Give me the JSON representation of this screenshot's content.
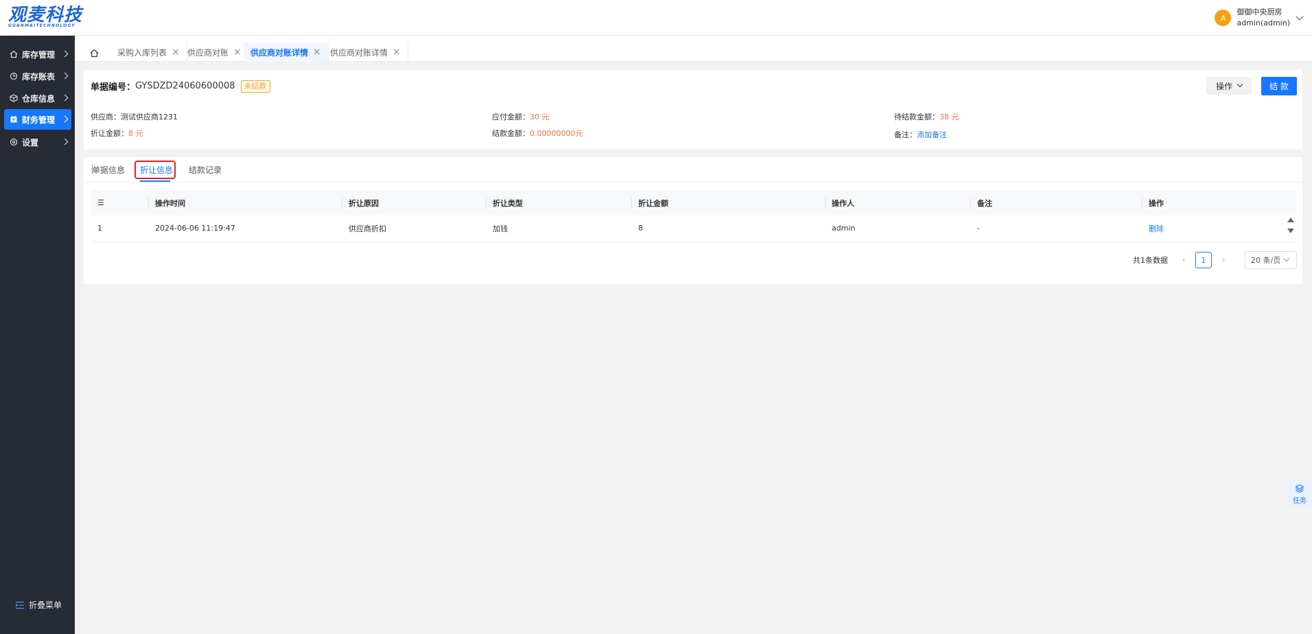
{
  "brand": {
    "name": "观麦科技",
    "subtitle": "GUANMAITECHNOLOGY"
  },
  "user": {
    "avatar_letter": "A",
    "shop": "御御中央厨房",
    "account": "admin(admin)"
  },
  "sidebar": {
    "items": [
      {
        "label": "库存管理",
        "icon": "home-icon"
      },
      {
        "label": "库存账表",
        "icon": "ledger-icon"
      },
      {
        "label": "仓库信息",
        "icon": "box-icon"
      },
      {
        "label": "财务管理",
        "icon": "finance-icon",
        "active": true
      },
      {
        "label": "设置",
        "icon": "gear-icon"
      }
    ],
    "collapse_label": "折叠菜单"
  },
  "tabs": [
    {
      "label": "采购入库列表"
    },
    {
      "label": "供应商对账"
    },
    {
      "label": "供应商对账详情",
      "active": true
    },
    {
      "label": "供应商对账详情"
    }
  ],
  "doc": {
    "number_label": "单据编号：",
    "number": "GYSDZD24060600008",
    "status": "未结款",
    "op_button": "操作",
    "settle_button": "结 款",
    "fields": {
      "supplier_label": "供应商：",
      "supplier": "测试供应商1231",
      "discount_label": "折让金额：",
      "discount": "8 元",
      "payable_label": "应付金额：",
      "payable": "30 元",
      "settled_label": "结款金额：",
      "settled": "0.00000000元",
      "pending_label": "待结款金额：",
      "pending": "38 元",
      "remark_label": "备注：",
      "remark_link": "添加备注"
    }
  },
  "subtabs": [
    {
      "label": "单据信息"
    },
    {
      "label": "折让信息",
      "active": true
    },
    {
      "label": "结款记录"
    }
  ],
  "table": {
    "index_header": "☰",
    "columns": [
      "操作时间",
      "折让原因",
      "折让类型",
      "折让金额",
      "操作人",
      "备注",
      "操作"
    ],
    "rows": [
      {
        "index": "1",
        "time": "2024-06-06 11:19:47",
        "reason": "供应商折扣",
        "type": "加钱",
        "amount": "8",
        "operator": "admin",
        "remark": "-",
        "action": "删除"
      }
    ]
  },
  "pagination": {
    "total_text": "共1条数据",
    "current": "1",
    "page_size": "20 条/页"
  },
  "float_task": {
    "label": "任务"
  },
  "colors": {
    "primary": "#1677ff",
    "sidebar": "#272b33",
    "warning": "#f5a623",
    "amount": "#fa6e3d",
    "highlight": "#e02020"
  }
}
